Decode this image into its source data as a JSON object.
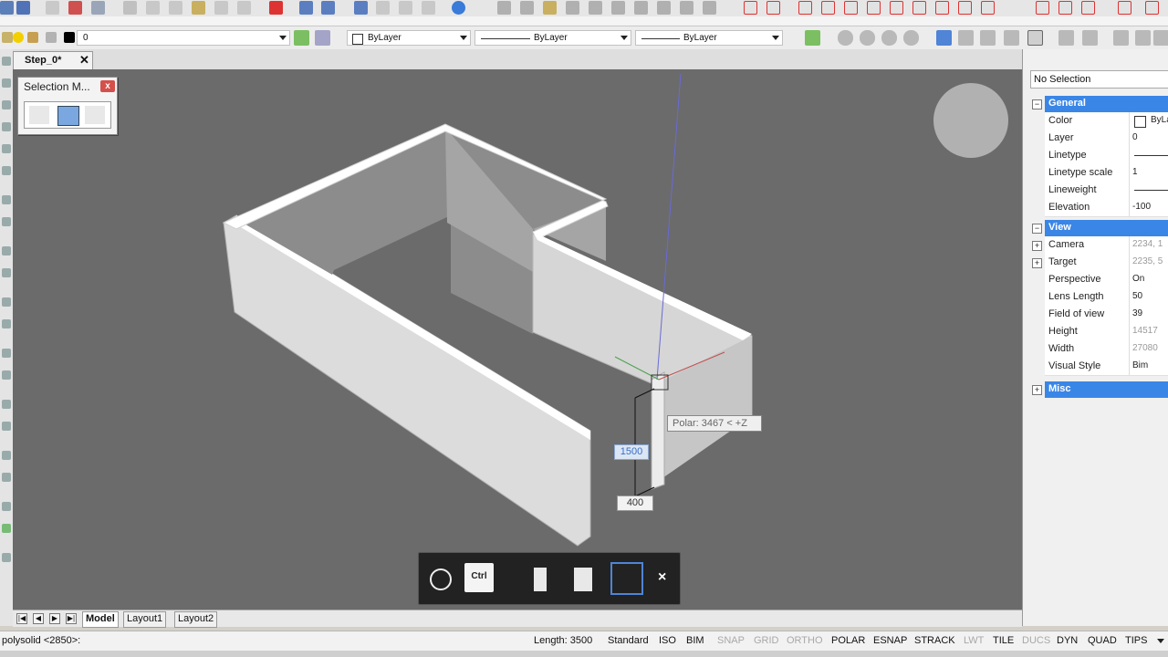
{
  "toolbar": {
    "layer_value": "0",
    "color_value": "ByLayer",
    "linetype_value": "ByLayer",
    "lineweight_value": "ByLayer"
  },
  "document_tab": {
    "name": "Step_0*",
    "close": "✕"
  },
  "selection_panel": {
    "title": "Selection M...",
    "close": "x"
  },
  "viewport": {
    "polar_tooltip": "Polar: 3467 < +Z",
    "dim_input_height": "1500",
    "dim_input_width": "400"
  },
  "quad_bar": {
    "ctrl_label": "Ctrl",
    "close": "×"
  },
  "properties": {
    "header": "No Selection",
    "categories": {
      "general": "General",
      "view": "View",
      "misc": "Misc"
    },
    "general": [
      {
        "key": "Color",
        "value": "ByLayer"
      },
      {
        "key": "Layer",
        "value": "0"
      },
      {
        "key": "Linetype",
        "value": ""
      },
      {
        "key": "Linetype scale",
        "value": "1"
      },
      {
        "key": "Lineweight",
        "value": ""
      },
      {
        "key": "Elevation",
        "value": "-100"
      }
    ],
    "view": [
      {
        "key": "Camera",
        "value": "2234, 1"
      },
      {
        "key": "Target",
        "value": "2235, 5"
      },
      {
        "key": "Perspective",
        "value": "On"
      },
      {
        "key": "Lens Length",
        "value": "50"
      },
      {
        "key": "Field of view",
        "value": "39"
      },
      {
        "key": "Height",
        "value": "14517"
      },
      {
        "key": "Width",
        "value": "27080"
      },
      {
        "key": "Visual Style",
        "value": "Bim"
      }
    ]
  },
  "layout_tabs": [
    "Model",
    "Layout1",
    "Layout2"
  ],
  "status_bar": {
    "command": "polysolid <2850>:",
    "length": "Length: 3500",
    "items": [
      {
        "label": "Standard",
        "on": true
      },
      {
        "label": "ISO",
        "on": true
      },
      {
        "label": "BIM",
        "on": true
      },
      {
        "label": "SNAP",
        "on": false
      },
      {
        "label": "GRID",
        "on": false
      },
      {
        "label": "ORTHO",
        "on": false
      },
      {
        "label": "POLAR",
        "on": true
      },
      {
        "label": "ESNAP",
        "on": true
      },
      {
        "label": "STRACK",
        "on": true
      },
      {
        "label": "LWT",
        "on": false
      },
      {
        "label": "TILE",
        "on": true
      },
      {
        "label": "DUCS",
        "on": false
      },
      {
        "label": "DYN",
        "on": true
      },
      {
        "label": "QUAD",
        "on": true
      },
      {
        "label": "TIPS",
        "on": true
      }
    ]
  }
}
